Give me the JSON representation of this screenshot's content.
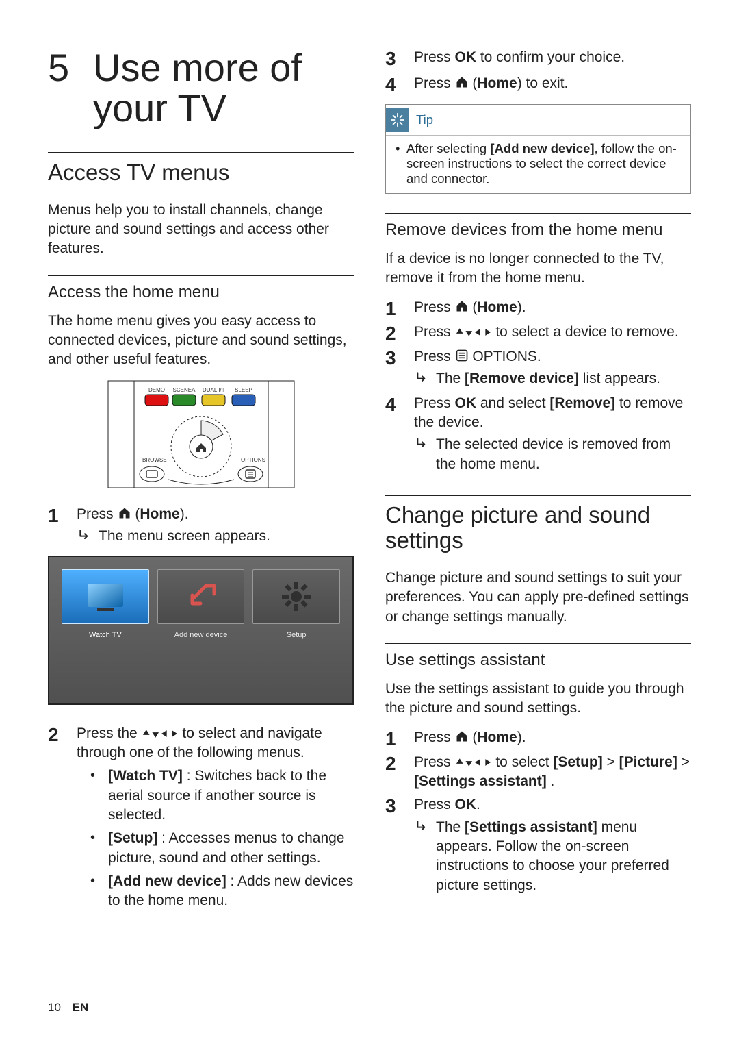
{
  "chapter": {
    "number": "5",
    "title": "Use more of your TV"
  },
  "section_access": {
    "heading": "Access TV menus",
    "intro": "Menus help you to install channels, change picture and sound settings and access other features."
  },
  "sub_home": {
    "heading": "Access the home menu",
    "intro": "The home menu gives you easy access to connected devices, picture and sound settings, and other useful features.",
    "remote_labels": {
      "demo": "DEMO",
      "scenea": "SCENEA",
      "dual": "DUAL I/II",
      "sleep": "SLEEP",
      "browse": "BROWSE",
      "options": "OPTIONS"
    },
    "step1_a": "Press ",
    "step1_b": " (",
    "step1_home": "Home",
    "step1_c": ").",
    "step1_result": "The menu screen appears.",
    "tiles": {
      "watch": "Watch TV",
      "add": "Add new device",
      "setup": "Setup"
    },
    "step2_a": "Press the ",
    "step2_b": " to select and navigate through one of the following menus.",
    "step2_items": {
      "watch_l": "[Watch TV]",
      "watch_t": " : Switches back to the aerial source if another source is selected.",
      "setup_l": "[Setup]",
      "setup_t": " : Accesses menus to change picture, sound and other settings.",
      "add_l": "[Add new device]",
      "add_t": " : Adds new devices to the home menu."
    },
    "step3_a": "Press ",
    "step3_ok": "OK",
    "step3_b": " to confirm your choice.",
    "step4_a": "Press ",
    "step4_b": " (",
    "step4_home": "Home",
    "step4_c": ") to exit."
  },
  "tip": {
    "label": "Tip",
    "text_a": "After selecting ",
    "text_bold": "[Add new device]",
    "text_b": ", follow the on-screen instructions to select the correct device and connector."
  },
  "sub_remove": {
    "heading": "Remove devices from the home menu",
    "intro": "If a device is no longer connected to the TV, remove it from the home menu.",
    "s1_a": "Press ",
    "s1_b": " (",
    "s1_home": "Home",
    "s1_c": ").",
    "s2_a": "Press ",
    "s2_b": " to select a device to remove.",
    "s3_a": "Press ",
    "s3_b": " OPTIONS.",
    "s3_result_a": "The ",
    "s3_result_bold": "[Remove device]",
    "s3_result_b": " list appears.",
    "s4_a": "Press ",
    "s4_ok": "OK",
    "s4_b": " and select ",
    "s4_rem": "[Remove]",
    "s4_c": " to remove the device.",
    "s4_result": "The selected device is removed from the home menu."
  },
  "section_change": {
    "heading": "Change picture and sound settings",
    "intro": "Change picture and sound settings to suit your preferences. You can apply pre-defined settings or change settings manually."
  },
  "sub_assistant": {
    "heading": "Use settings assistant",
    "intro": "Use the settings assistant to guide you through the picture and sound settings.",
    "s1_a": "Press ",
    "s1_b": " (",
    "s1_home": "Home",
    "s1_c": ").",
    "s2_a": "Press ",
    "s2_b": " to select ",
    "s2_setup": "[Setup]",
    "s2_gt1": " > ",
    "s2_pic": "[Picture]",
    "s2_gt2": " >",
    "s2_sa": "[Settings assistant]",
    "s2_dot": " .",
    "s3_a": "Press ",
    "s3_ok": "OK",
    "s3_b": ".",
    "s3_result_a": "The ",
    "s3_result_bold": "[Settings assistant]",
    "s3_result_b": " menu appears. Follow the on-screen instructions to choose your preferred picture settings."
  },
  "footer": {
    "page": "10",
    "lang": "EN"
  }
}
